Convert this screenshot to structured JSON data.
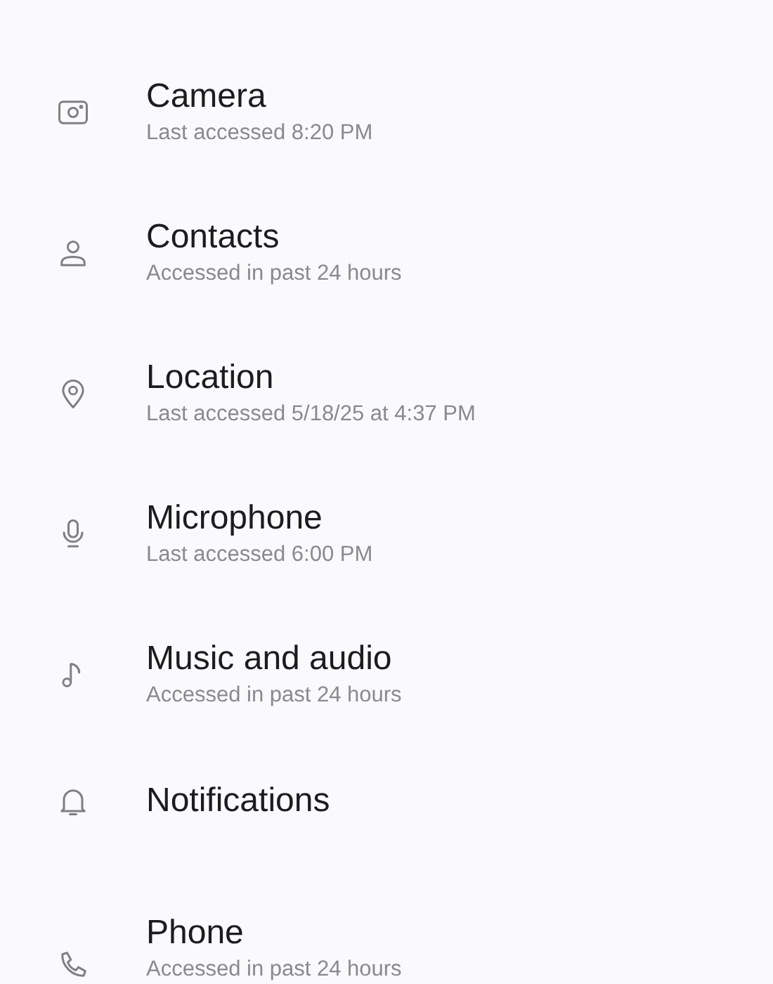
{
  "permissions": [
    {
      "kind": "camera",
      "title": "Camera",
      "subtitle": "Last accessed 8:20 PM"
    },
    {
      "kind": "person",
      "title": "Contacts",
      "subtitle": "Accessed in past 24 hours"
    },
    {
      "kind": "pin",
      "title": "Location",
      "subtitle": "Last accessed 5/18/25 at 4:37 PM"
    },
    {
      "kind": "mic",
      "title": "Microphone",
      "subtitle": "Last accessed 6:00 PM"
    },
    {
      "kind": "note",
      "title": "Music and audio",
      "subtitle": "Accessed in past 24 hours"
    },
    {
      "kind": "bell",
      "title": "Notifications"
    },
    {
      "kind": "phone",
      "title": "Phone",
      "subtitle": "Accessed in past 24 hours"
    }
  ]
}
